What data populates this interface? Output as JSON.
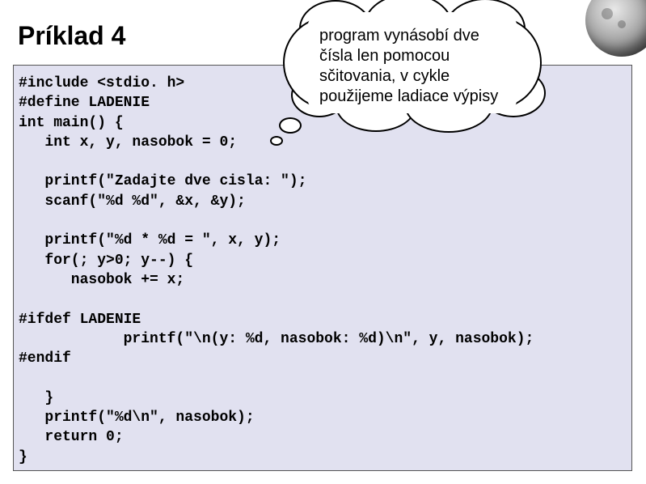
{
  "title": "Príklad 4",
  "bubble": {
    "line1": "program vynásobí dve",
    "line2": "čísla len pomocou",
    "line3": "sčitovania, v cykle",
    "line4": "použijeme ladiace výpisy"
  },
  "code": {
    "l1": "#include <stdio. h>",
    "l2": "#define LADENIE",
    "l3": "int main() {",
    "l4": "   int x, y, nasobok = 0;",
    "l5": "",
    "l6": "   printf(\"Zadajte dve cisla: \");",
    "l7": "   scanf(\"%d %d\", &x, &y);",
    "l8": "",
    "l9": "   printf(\"%d * %d = \", x, y);",
    "l10": "   for(; y>0; y--) {",
    "l11": "      nasobok += x;",
    "l12": "",
    "l13": "#ifdef LADENIE",
    "l14": "            printf(\"\\n(y: %d, nasobok: %d)\\n\", y, nasobok);",
    "l15": "#endif",
    "l16": "",
    "l17": "   }",
    "l18": "   printf(\"%d\\n\", nasobok);",
    "l19": "   return 0;",
    "l20": "}"
  }
}
